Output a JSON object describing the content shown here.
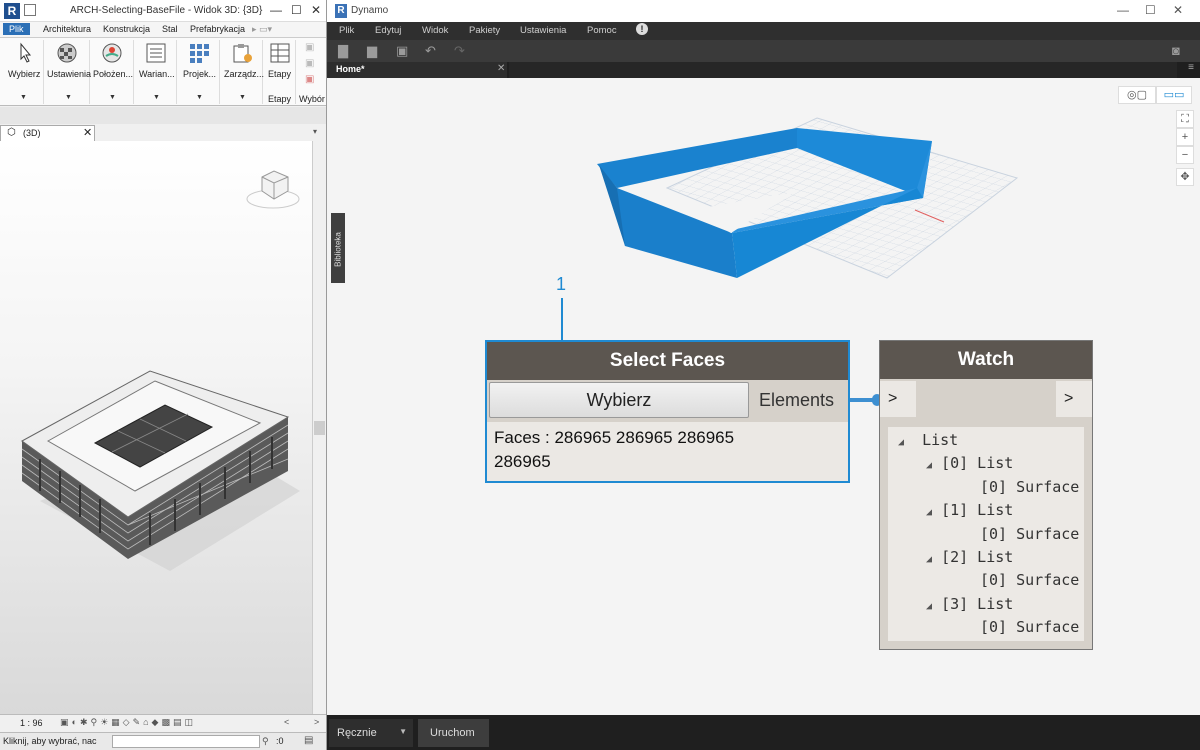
{
  "revit": {
    "title": "ARCH-Selecting-BaseFile - Widok 3D: {3D}",
    "menu": [
      "Plik",
      "Architektura",
      "Konstrukcja",
      "Stal",
      "Prefabrykacja"
    ],
    "ribbon": [
      {
        "label": "Wybierz",
        "icon": "cursor-icon"
      },
      {
        "label": "Ustawienia",
        "icon": "checker-sphere-icon"
      },
      {
        "label": "Położen...",
        "icon": "globe-icon"
      },
      {
        "label": "Warian...",
        "icon": "window-list-icon"
      },
      {
        "label": "Projek...",
        "icon": "grid-icon"
      },
      {
        "label": "Zarządz...",
        "icon": "manage-icon"
      },
      {
        "label": "Etapy",
        "icon": "phases-icon"
      }
    ],
    "ribbon_panel_label": "Etapy",
    "ribbon_extra_label": "Wybór",
    "view_tab": "(3D)",
    "scale": "1 : 96",
    "status": "Kliknij, aby wybrać, nac",
    "status_count": ":0"
  },
  "dynamo": {
    "title": "Dynamo",
    "menu": [
      "Plik",
      "Edytuj",
      "Widok",
      "Pakiety",
      "Ustawienia",
      "Pomoc"
    ],
    "tab": "Home*",
    "library": "Biblioteka",
    "annotation": "1",
    "select_node": {
      "title": "Select Faces",
      "button": "Wybierz",
      "output": "Elements",
      "faces_line1": "Faces : 286965 286965 286965",
      "faces_line2": "286965"
    },
    "watch_node": {
      "title": "Watch",
      "in_port": ">",
      "out_port": ">",
      "tree": {
        "root": "List",
        "items": [
          {
            "label": "[0] List",
            "child": "[0] Surface"
          },
          {
            "label": "[1] List",
            "child": "[0] Surface"
          },
          {
            "label": "[2] List",
            "child": "[0] Surface"
          },
          {
            "label": "[3] List",
            "child": "[0] Surface"
          }
        ]
      }
    },
    "run_mode": "Ręcznie",
    "run_button": "Uruchom",
    "accent": "#1f8ad2",
    "wire_color": "#3d8fd1"
  }
}
